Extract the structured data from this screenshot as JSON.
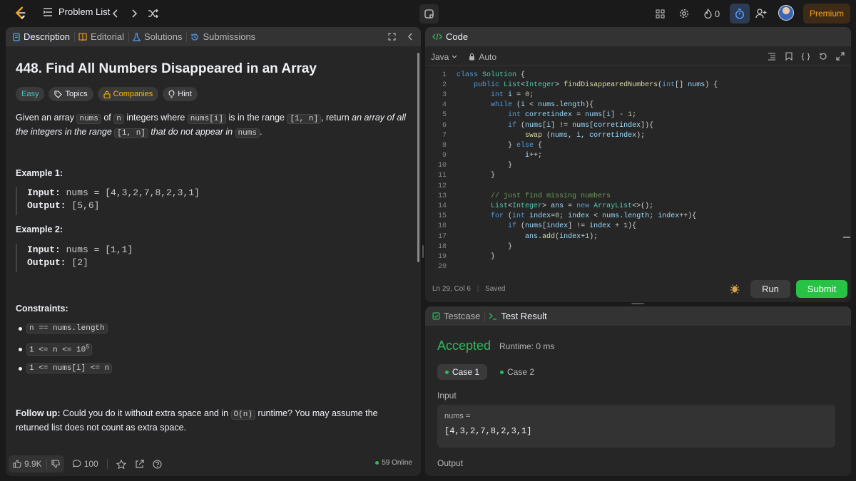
{
  "topbar": {
    "problem_list_label": "Problem List",
    "streak_count": "0",
    "premium_label": "Premium"
  },
  "left_panel": {
    "tabs": [
      "Description",
      "Editorial",
      "Solutions",
      "Submissions"
    ],
    "title": "448. Find All Numbers Disappeared in an Array",
    "chips": [
      "Easy",
      "Topics",
      "Companies",
      "Hint"
    ],
    "desc": {
      "p1": "Given an array ",
      "c1": "nums",
      "p2": " of ",
      "c2": "n",
      "p3": " integers where ",
      "c3": "nums[i]",
      "p4": " is in the range ",
      "c4": "[1, n]",
      "p5": ", return ",
      "em1": "an array of all the integers in the range ",
      "c5": "[1, n]",
      "em2": " that do not appear in ",
      "c6": "nums",
      "p6": "."
    },
    "example1": {
      "heading": "Example 1:",
      "input_label": "Input:",
      "input_value": "nums = [4,3,2,7,8,2,3,1]",
      "output_label": "Output:",
      "output_value": "[5,6]"
    },
    "example2": {
      "heading": "Example 2:",
      "input_label": "Input:",
      "input_value": "nums = [1,1]",
      "output_label": "Output:",
      "output_value": "[2]"
    },
    "constraints_heading": "Constraints:",
    "constraints": [
      "n == nums.length",
      "1 <= n <= 10",
      "1 <= nums[i] <= n"
    ],
    "constraint_sup": "5",
    "followup_label": "Follow up:",
    "followup_text1": " Could you do it without extra space and in ",
    "followup_code": "O(n)",
    "followup_text2": " runtime? You may assume the returned list does not count as extra space.",
    "likes": "9.9K",
    "comments": "100",
    "online": "59 Online"
  },
  "code_panel": {
    "tab": "Code",
    "language": "Java",
    "mode": "Auto",
    "line_numbers": [
      "1",
      "2",
      "3",
      "4",
      "5",
      "6",
      "7",
      "8",
      "9",
      "10",
      "11",
      "12",
      "13",
      "14",
      "15",
      "16",
      "17",
      "18",
      "19",
      "20"
    ],
    "status_pos": "Ln 29, Col 6",
    "status_saved": "Saved",
    "run_label": "Run",
    "submit_label": "Submit"
  },
  "result_panel": {
    "tabs": [
      "Testcase",
      "Test Result"
    ],
    "verdict": "Accepted",
    "runtime": "Runtime: 0 ms",
    "cases": [
      "Case 1",
      "Case 2"
    ],
    "input_label": "Input",
    "input_key": "nums =",
    "input_value": "[4,3,2,7,8,2,3,1]",
    "output_label": "Output"
  },
  "colors": {
    "accent_green": "#2cbb5d",
    "submit_green": "#28c244",
    "easy": "#46c6c2",
    "premium": "#ffa116"
  }
}
